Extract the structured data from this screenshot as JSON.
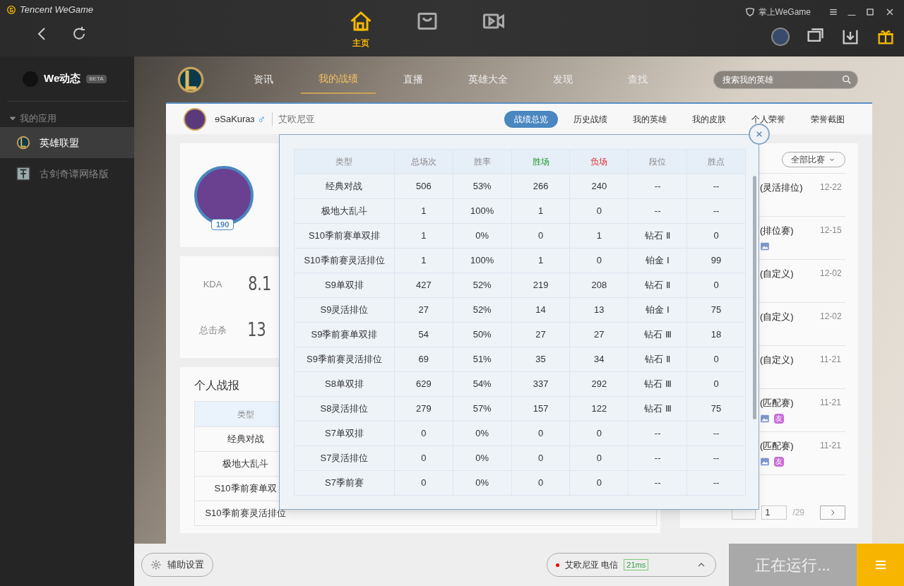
{
  "titlebar": {
    "brand": "Tencent WeGame",
    "mobile_link": "掌上WeGame",
    "nav": [
      {
        "kind": "home",
        "label": "主页",
        "selected": true
      },
      {
        "kind": "store",
        "selected": false
      },
      {
        "kind": "video",
        "selected": false
      }
    ]
  },
  "sidebar": {
    "feed": {
      "label": "We动态",
      "badge": "BETA"
    },
    "section": {
      "label": "我的应用",
      "expanded": true
    },
    "items": [
      {
        "kind": "lol",
        "label": "英雄联盟",
        "selected": true
      },
      {
        "kind": "sword",
        "label": "古剑奇谭网络版",
        "selected": false
      }
    ]
  },
  "game_nav": {
    "items": [
      {
        "label": "资讯",
        "selected": false
      },
      {
        "label": "我的战绩",
        "selected": true
      },
      {
        "label": "直播",
        "selected": false
      },
      {
        "label": "英雄大全",
        "selected": false
      },
      {
        "label": "发现",
        "selected": false
      },
      {
        "label": "查找",
        "selected": false
      }
    ],
    "search": {
      "placeholder": "搜索我的英雄"
    }
  },
  "profile": {
    "name": "ɘSaKuraɜ",
    "gender": "♂",
    "server": "艾欧尼亚",
    "tabs": [
      {
        "label": "战绩总览",
        "selected": true
      },
      {
        "label": "历史战绩",
        "selected": false
      },
      {
        "label": "我的英雄",
        "selected": false
      },
      {
        "label": "我的皮肤",
        "selected": false
      },
      {
        "label": "个人荣誉",
        "selected": false
      },
      {
        "label": "荣誉截图",
        "selected": false
      }
    ],
    "level": "190"
  },
  "stats": [
    {
      "label": "KDA",
      "value": "8.1"
    },
    {
      "label": "总击杀",
      "value": "13"
    }
  ],
  "report": {
    "title": "个人战报",
    "header": "类型",
    "rows": [
      "经典对战",
      "极地大乱斗",
      "S10季前赛单双",
      "S10季前赛灵活排位"
    ]
  },
  "matches": {
    "filter": "全部比赛",
    "items": [
      {
        "mode": "(灵活排位)",
        "date": "12-22"
      },
      {
        "mode": "(排位赛)",
        "date": "12-15",
        "tags": [
          {
            "kind": "image"
          }
        ]
      },
      {
        "mode": "(自定义)",
        "date": "12-02"
      },
      {
        "mode": "(自定义)",
        "date": "12-02"
      },
      {
        "mode": "(自定义)",
        "date": "11-21"
      },
      {
        "mode": "(匹配赛)",
        "date": "11-21",
        "tags": [
          {
            "kind": "image"
          },
          {
            "kind": "friend",
            "text": "友",
            "color": "#c86dd7"
          }
        ]
      },
      {
        "mode": "(匹配赛)",
        "date": "11-21",
        "tags": [
          {
            "kind": "image"
          },
          {
            "kind": "friend",
            "text": "友",
            "color": "#c86dd7"
          }
        ]
      }
    ],
    "page": "1",
    "total": "/29"
  },
  "overview_popup": {
    "columns": [
      {
        "label": "类型",
        "kind": "plain"
      },
      {
        "label": "总场次",
        "kind": "plain"
      },
      {
        "label": "胜率",
        "kind": "plain"
      },
      {
        "label": "胜场",
        "kind": "win"
      },
      {
        "label": "负场",
        "kind": "loss"
      },
      {
        "label": "段位",
        "kind": "plain"
      },
      {
        "label": "胜点",
        "kind": "plain"
      }
    ],
    "rows": [
      [
        "经典对战",
        "506",
        "53%",
        "266",
        "240",
        "--",
        "--"
      ],
      [
        "极地大乱斗",
        "1",
        "100%",
        "1",
        "0",
        "--",
        "--"
      ],
      [
        "S10季前赛单双排",
        "1",
        "0%",
        "0",
        "1",
        "钻石 Ⅱ",
        "0"
      ],
      [
        "S10季前赛灵活排位",
        "1",
        "100%",
        "1",
        "0",
        "铂金 Ⅰ",
        "99"
      ],
      [
        "S9单双排",
        "427",
        "52%",
        "219",
        "208",
        "钻石 Ⅱ",
        "0"
      ],
      [
        "S9灵活排位",
        "27",
        "52%",
        "14",
        "13",
        "铂金 Ⅰ",
        "75"
      ],
      [
        "S9季前赛单双排",
        "54",
        "50%",
        "27",
        "27",
        "钻石 Ⅲ",
        "18"
      ],
      [
        "S9季前赛灵活排位",
        "69",
        "51%",
        "35",
        "34",
        "钻石 Ⅱ",
        "0"
      ],
      [
        "S8单双排",
        "629",
        "54%",
        "337",
        "292",
        "钻石 Ⅲ",
        "0"
      ],
      [
        "S8灵活排位",
        "279",
        "57%",
        "157",
        "122",
        "钻石 Ⅲ",
        "75"
      ],
      [
        "S7单双排",
        "0",
        "0%",
        "0",
        "0",
        "--",
        "--"
      ],
      [
        "S7灵活排位",
        "0",
        "0%",
        "0",
        "0",
        "--",
        "--"
      ],
      [
        "S7季前赛",
        "0",
        "0%",
        "0",
        "0",
        "--",
        "--"
      ]
    ]
  },
  "bottom_bar": {
    "assist": "辅助设置",
    "server": {
      "name": "艾欧尼亚 电信",
      "ping": "21ms",
      "online": true
    },
    "status": "正在运行..."
  }
}
